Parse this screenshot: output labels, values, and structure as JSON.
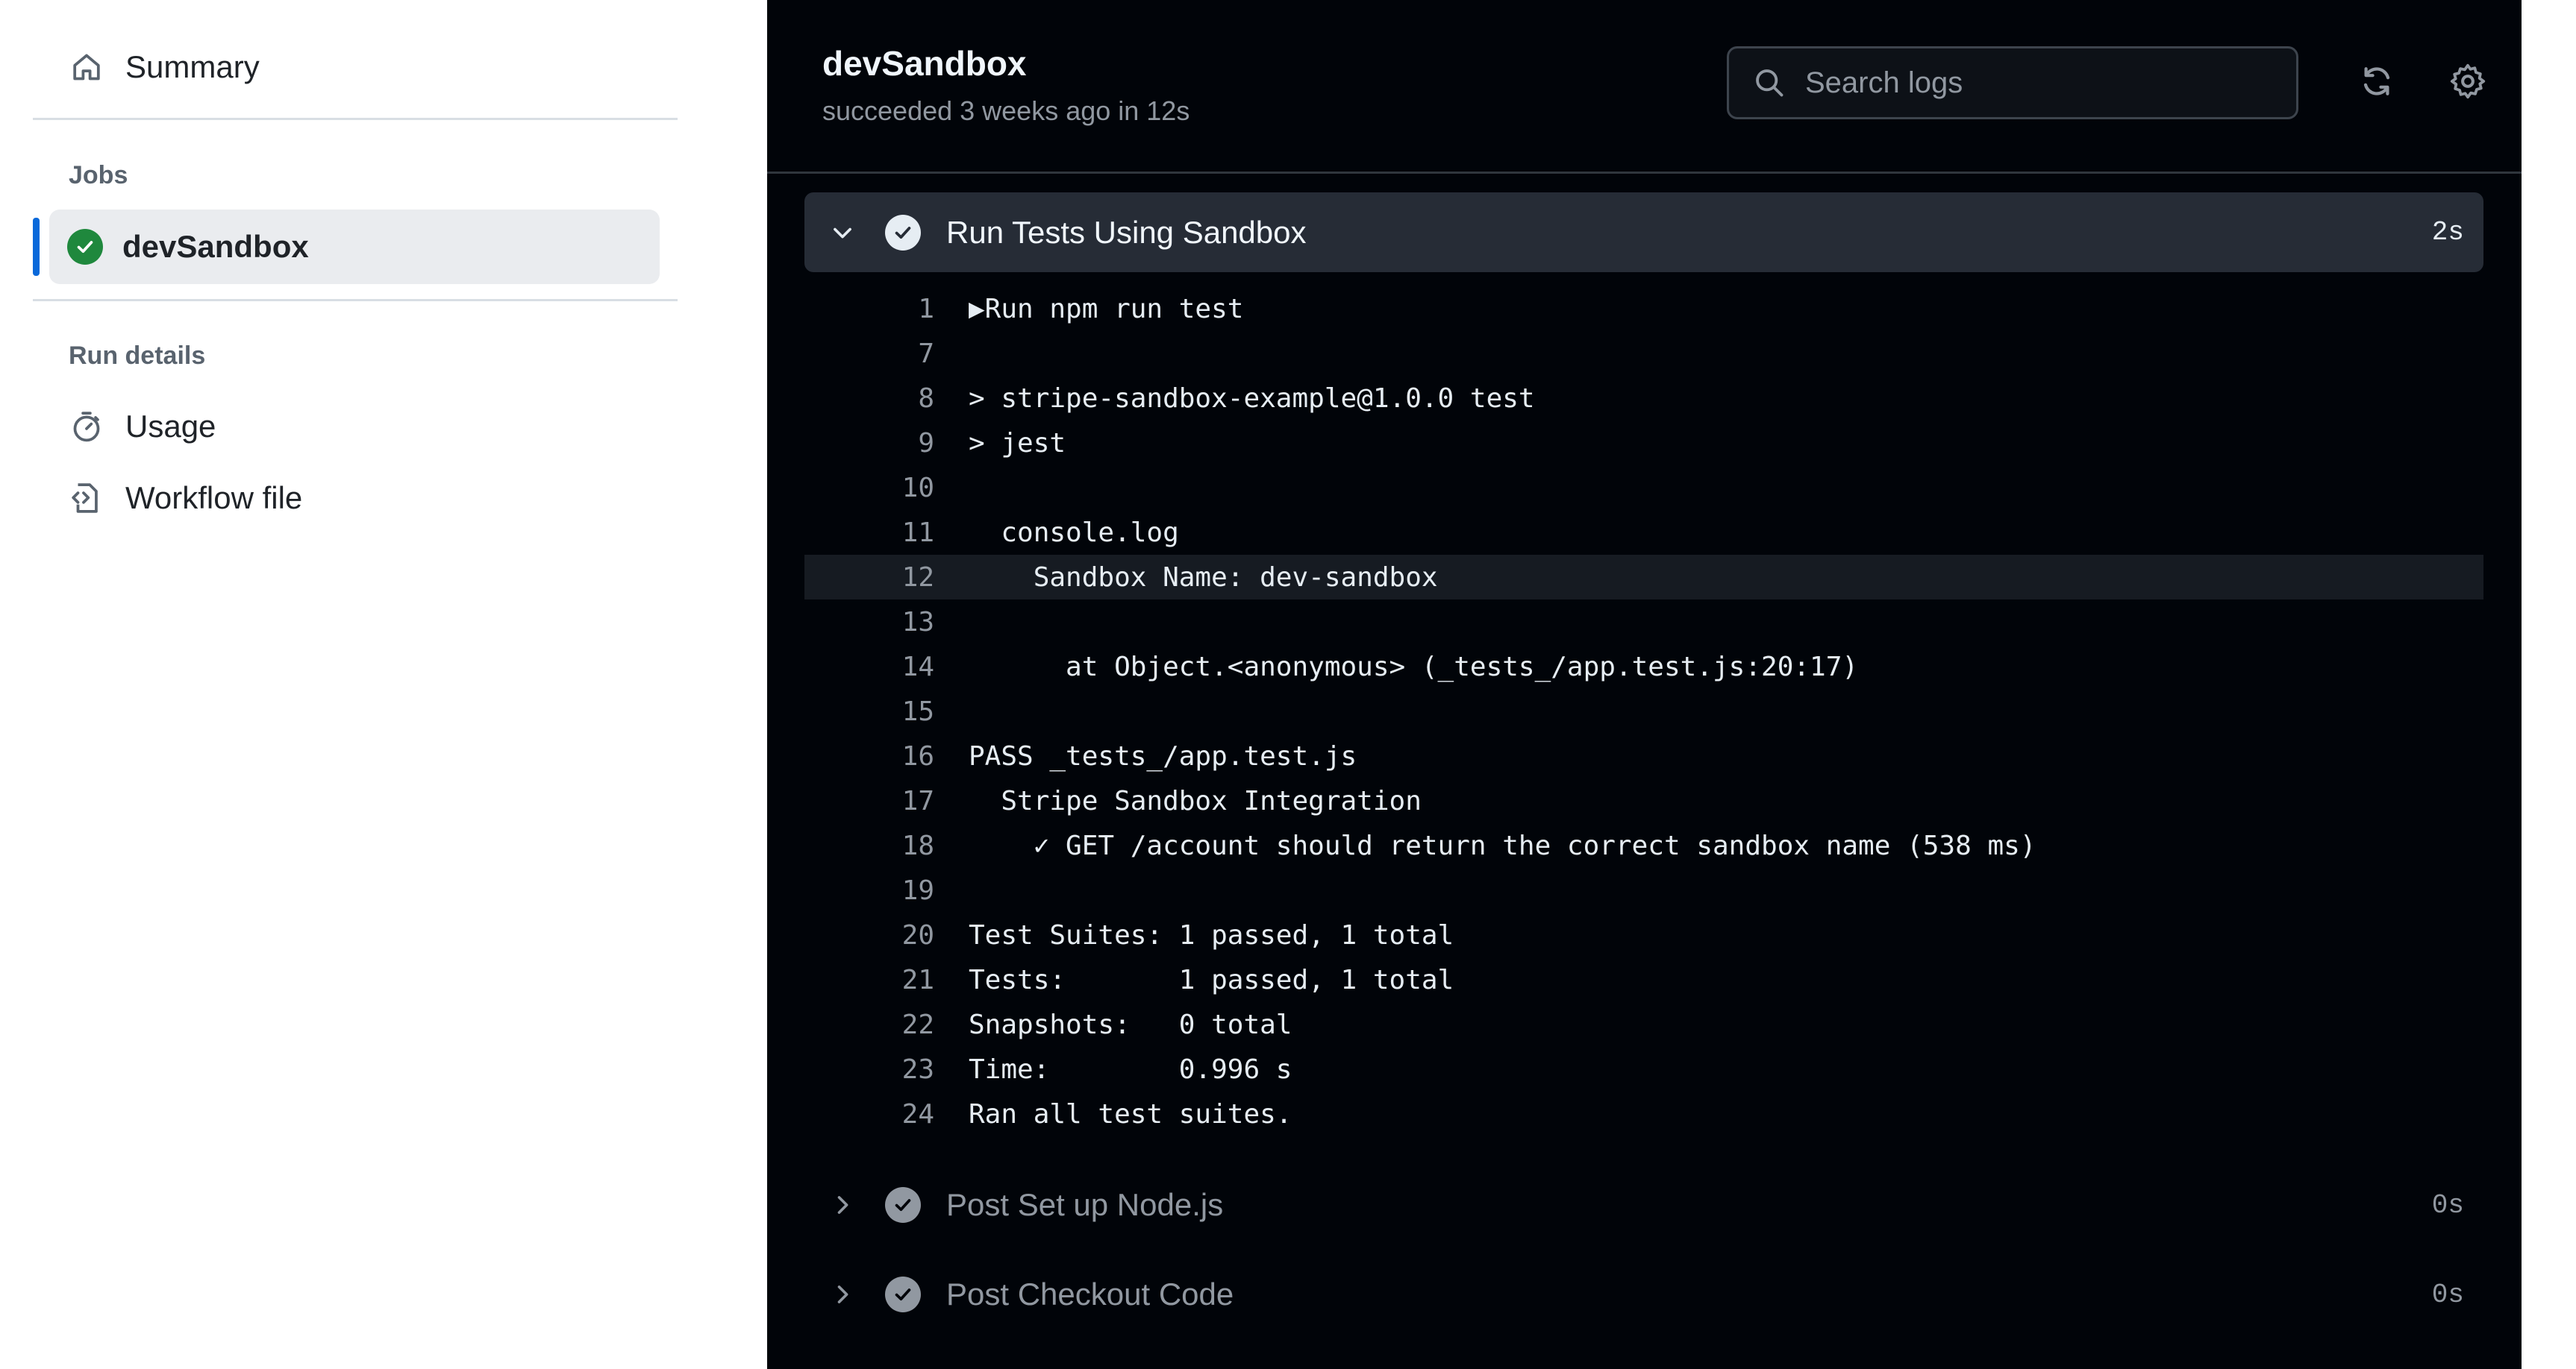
{
  "sidebar": {
    "summary_label": "Summary",
    "jobs_heading": "Jobs",
    "job_label": "devSandbox",
    "run_details_heading": "Run details",
    "usage_label": "Usage",
    "workflow_file_label": "Workflow file"
  },
  "header": {
    "title": "devSandbox",
    "status": "succeeded 3 weeks ago in 12s",
    "search_placeholder": "Search logs"
  },
  "steps": {
    "open": {
      "name": "Run Tests Using Sandbox",
      "duration": "2s"
    },
    "collapsed": [
      {
        "name": "Post Set up Node.js",
        "duration": "0s"
      },
      {
        "name": "Post Checkout Code",
        "duration": "0s"
      }
    ]
  },
  "log_lines": [
    {
      "num": "1",
      "text": "▶Run npm run test"
    },
    {
      "num": "7",
      "text": ""
    },
    {
      "num": "8",
      "text": "> stripe-sandbox-example@1.0.0 test"
    },
    {
      "num": "9",
      "text": "> jest"
    },
    {
      "num": "10",
      "text": ""
    },
    {
      "num": "11",
      "text": "  console.log"
    },
    {
      "num": "12",
      "text": "    Sandbox Name: dev-sandbox",
      "highlight": true
    },
    {
      "num": "13",
      "text": ""
    },
    {
      "num": "14",
      "text": "      at Object.<anonymous> (_tests_/app.test.js:20:17)"
    },
    {
      "num": "15",
      "text": ""
    },
    {
      "num": "16",
      "text": "PASS _tests_/app.test.js"
    },
    {
      "num": "17",
      "text": "  Stripe Sandbox Integration"
    },
    {
      "num": "18",
      "text": "    ✓ GET /account should return the correct sandbox name (538 ms)"
    },
    {
      "num": "19",
      "text": ""
    },
    {
      "num": "20",
      "text": "Test Suites: 1 passed, 1 total"
    },
    {
      "num": "21",
      "text": "Tests:       1 passed, 1 total"
    },
    {
      "num": "22",
      "text": "Snapshots:   0 total"
    },
    {
      "num": "23",
      "text": "Time:        0.996 s"
    },
    {
      "num": "24",
      "text": "Ran all test suites."
    }
  ],
  "icons": {
    "summary": "home-icon",
    "job_status": "check-circle-icon",
    "usage": "stopwatch-icon",
    "workflow_file": "file-code-icon",
    "search": "search-icon",
    "refresh": "sync-icon",
    "settings": "gear-icon"
  },
  "colors": {
    "accent": "#0969da",
    "success": "#1f883d",
    "log_background": "#010409",
    "step_header_background": "#262c36"
  }
}
